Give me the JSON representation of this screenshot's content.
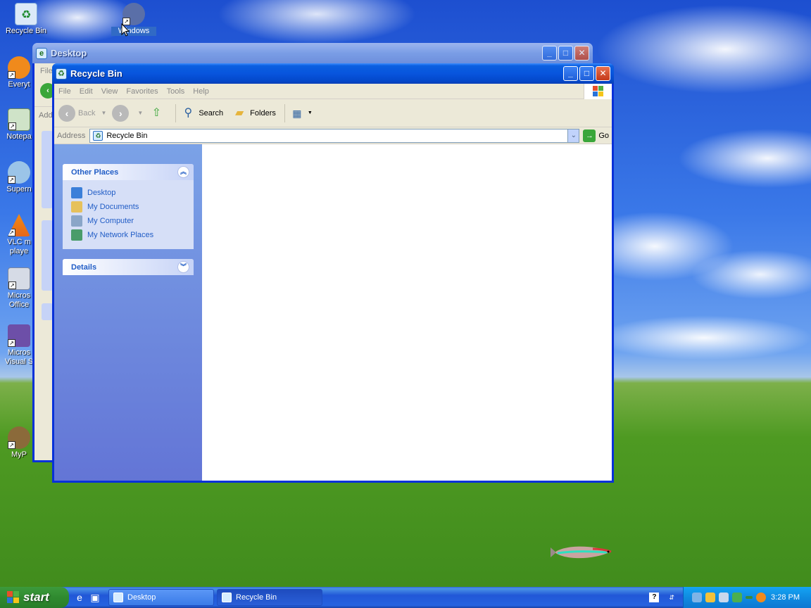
{
  "desktop": {
    "icons": [
      {
        "label": "Recycle Bin"
      },
      {
        "label": "Windows Movie Maker"
      },
      {
        "label": "Everyt"
      },
      {
        "label": "Notepa"
      },
      {
        "label": "Supern"
      },
      {
        "label": "VLC m playe"
      },
      {
        "label": "Micros Office"
      },
      {
        "label": "Micros Visual S"
      },
      {
        "label": "MyP"
      }
    ]
  },
  "back_window": {
    "title": "Desktop",
    "menu_first": "File",
    "address_label": "Add"
  },
  "window": {
    "title": "Recycle Bin",
    "menu": [
      "File",
      "Edit",
      "View",
      "Favorites",
      "Tools",
      "Help"
    ],
    "toolbar": {
      "back": "Back",
      "search": "Search",
      "folders": "Folders"
    },
    "address": {
      "label": "Address",
      "value": "Recycle Bin",
      "go": "Go"
    },
    "task_pane": {
      "other_places": {
        "title": "Other Places",
        "items": [
          {
            "label": "Desktop",
            "icon": "desktop-icon",
            "color": "#3b7fd9"
          },
          {
            "label": "My Documents",
            "icon": "my-documents-icon",
            "color": "#e6c15c"
          },
          {
            "label": "My Computer",
            "icon": "my-computer-icon",
            "color": "#8aa6c8"
          },
          {
            "label": "My Network Places",
            "icon": "network-places-icon",
            "color": "#4a9c6a"
          }
        ]
      },
      "details": {
        "title": "Details"
      }
    }
  },
  "taskbar": {
    "start": "start",
    "tasks": [
      {
        "label": "Desktop",
        "active": false
      },
      {
        "label": "Recycle Bin",
        "active": true
      }
    ],
    "clock": "3:28 PM"
  }
}
